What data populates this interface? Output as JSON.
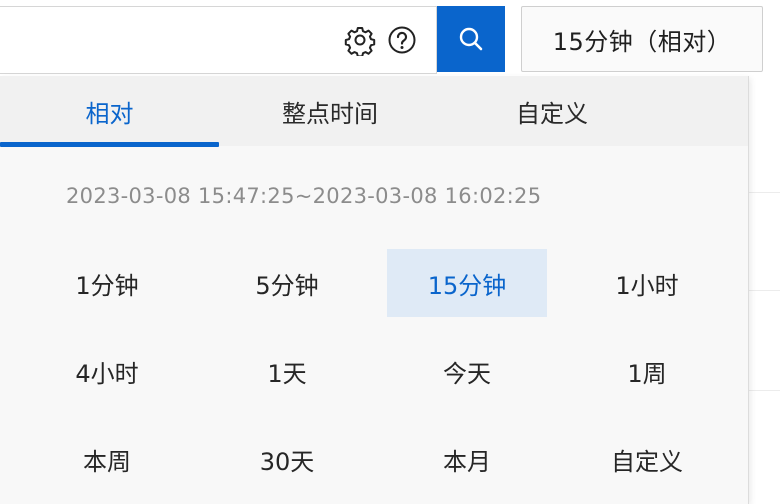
{
  "toolbar": {
    "range_button_label": "15分钟（相对）",
    "icons": {
      "settings": "gear-icon",
      "help": "help-icon",
      "search": "search-icon"
    },
    "accent_color": "#0a65cc"
  },
  "dropdown": {
    "tabs": [
      {
        "label": "相对",
        "active": true
      },
      {
        "label": "整点时间",
        "active": false
      },
      {
        "label": "自定义",
        "active": false
      }
    ],
    "range_text": "2023-03-08 15:47:25~2023-03-08 16:02:25",
    "options": [
      {
        "label": "1分钟",
        "selected": false
      },
      {
        "label": "5分钟",
        "selected": false
      },
      {
        "label": "15分钟",
        "selected": true
      },
      {
        "label": "1小时",
        "selected": false
      },
      {
        "label": "4小时",
        "selected": false
      },
      {
        "label": "1天",
        "selected": false
      },
      {
        "label": "今天",
        "selected": false
      },
      {
        "label": "1周",
        "selected": false
      },
      {
        "label": "本周",
        "selected": false
      },
      {
        "label": "30天",
        "selected": false
      },
      {
        "label": "本月",
        "selected": false
      },
      {
        "label": "自定义",
        "selected": false
      }
    ]
  }
}
